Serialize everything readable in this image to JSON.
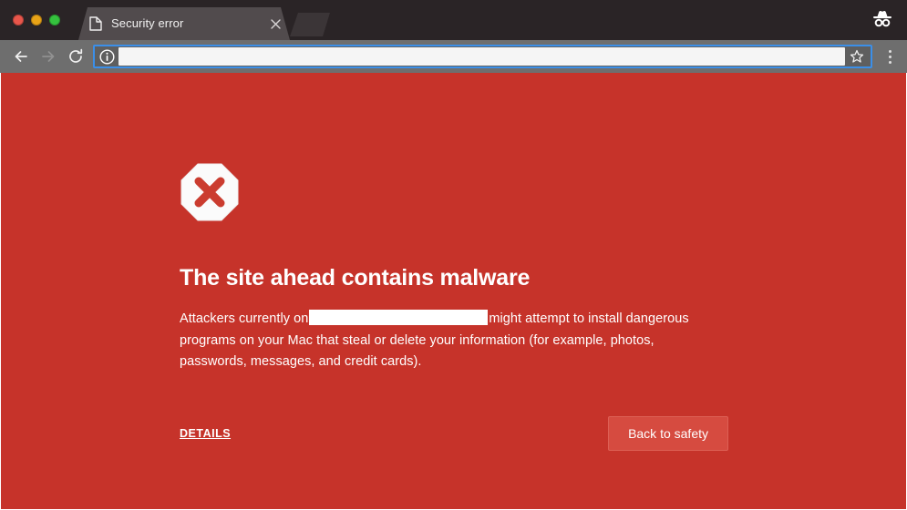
{
  "window": {
    "traffic_lights": [
      {
        "name": "close",
        "color": "#e8564b"
      },
      {
        "name": "minimize",
        "color": "#e8a317"
      },
      {
        "name": "zoom",
        "color": "#35c23e"
      }
    ],
    "incognito_icon": "incognito-icon"
  },
  "tab_strip": {
    "tabs": [
      {
        "title": "Security error",
        "favicon": "page-document-icon",
        "close_icon": "close-icon",
        "active": true
      }
    ],
    "new_tab_label": ""
  },
  "toolbar": {
    "back_icon": "back-arrow-icon",
    "forward_icon": "forward-arrow-icon",
    "reload_icon": "reload-icon",
    "menu_icon": "three-dot-menu-icon",
    "omnibox": {
      "security_icon": "info-circle-icon",
      "value": "",
      "placeholder": "",
      "redacted": true,
      "bookmark_icon": "star-icon",
      "focus_ring_color": "#3b8fe8"
    }
  },
  "page": {
    "background_color": "#c6332a",
    "icon": "octagon-x-malware-icon",
    "headline": "The site ahead contains malware",
    "body_prefix": "Attackers currently on",
    "body_redacted_site": "",
    "body_suffix": "might attempt to install dangerous programs on your Mac that steal or delete your information (for example, photos, passwords, messages, and credit cards).",
    "details_label": "DETAILS",
    "back_to_safety_label": "Back to safety",
    "button_color": "#d64b40"
  }
}
